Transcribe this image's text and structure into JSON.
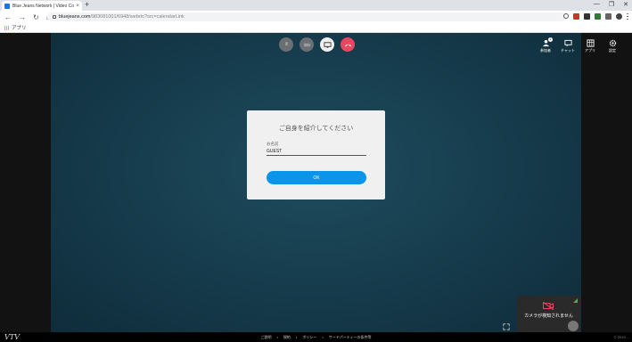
{
  "browser": {
    "tab_title": "Blue Jeans Network | Video Coll...",
    "tab_close": "×",
    "new_tab": "+",
    "url_host": "bluejeans.com",
    "url_path": "/983081001/6948/webrtc?src=calendarLink",
    "bookmark_label": "アプリ",
    "window_controls": [
      "—",
      "❐",
      "✕"
    ]
  },
  "meeting": {
    "right_bar": [
      {
        "label": "参加者",
        "icon": "participants-icon",
        "badge": "1"
      },
      {
        "label": "チャット",
        "icon": "chat-icon"
      },
      {
        "label": "アプリ",
        "icon": "apps-icon"
      },
      {
        "label": "設定",
        "icon": "settings-icon"
      }
    ],
    "controls": {
      "mute_icon": "microphone-icon",
      "video_icon": "camera-icon",
      "share_icon": "screen-share-icon",
      "hangup_icon": "hangup-icon"
    }
  },
  "dialog": {
    "title": "ご自身を紹介してください",
    "name_label": "お名前",
    "name_value": "GUEST",
    "ok_label": "OK"
  },
  "selfview": {
    "message": "カメラが検知されません"
  },
  "footer": {
    "logo": "VTV",
    "links": [
      "ご説明",
      "•",
      "規約",
      "•",
      "ポリシー",
      "•",
      "サードパーティーの条件等"
    ],
    "right": "© 2019 ..."
  },
  "colors": {
    "accent": "#0a95ea",
    "hangup": "#e8475f",
    "stage_bg": "#173e4f"
  }
}
